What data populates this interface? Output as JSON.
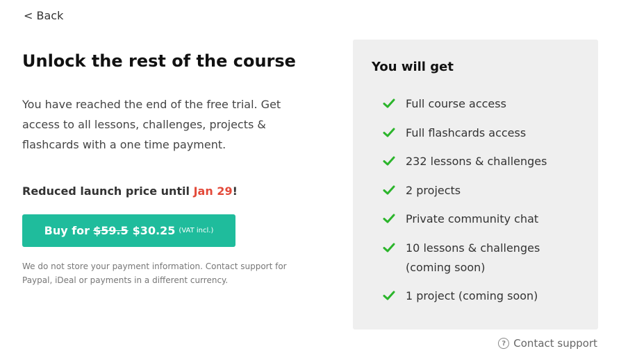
{
  "back": {
    "label": "< Back"
  },
  "title": "Unlock the rest of the course",
  "description": "You have reached the end of the free trial. Get access to all lessons, challenges, projects & flashcards with a one time payment.",
  "promo": {
    "prefix": "Reduced launch price until ",
    "date": "Jan 29",
    "suffix": "!"
  },
  "buy_button": {
    "prefix": "Buy for",
    "old_price": "$59.5",
    "new_price": "$30.25",
    "vat": "(VAT incl.)"
  },
  "note": "We do not store your payment information. Contact support for Paypal, iDeal or payments in a different currency.",
  "panel": {
    "heading": "You will get",
    "features": [
      "Full course access",
      "Full flashcards access",
      "232 lessons & challenges",
      "2 projects",
      "Private community chat",
      "10 lessons & challenges (coming soon)",
      "1 project (coming soon)"
    ]
  },
  "support": {
    "label": "Contact support"
  },
  "colors": {
    "accent": "#1fbc9c",
    "date_red": "#e34a3a",
    "check_green": "#2bb52b",
    "panel_bg": "#efefef"
  }
}
